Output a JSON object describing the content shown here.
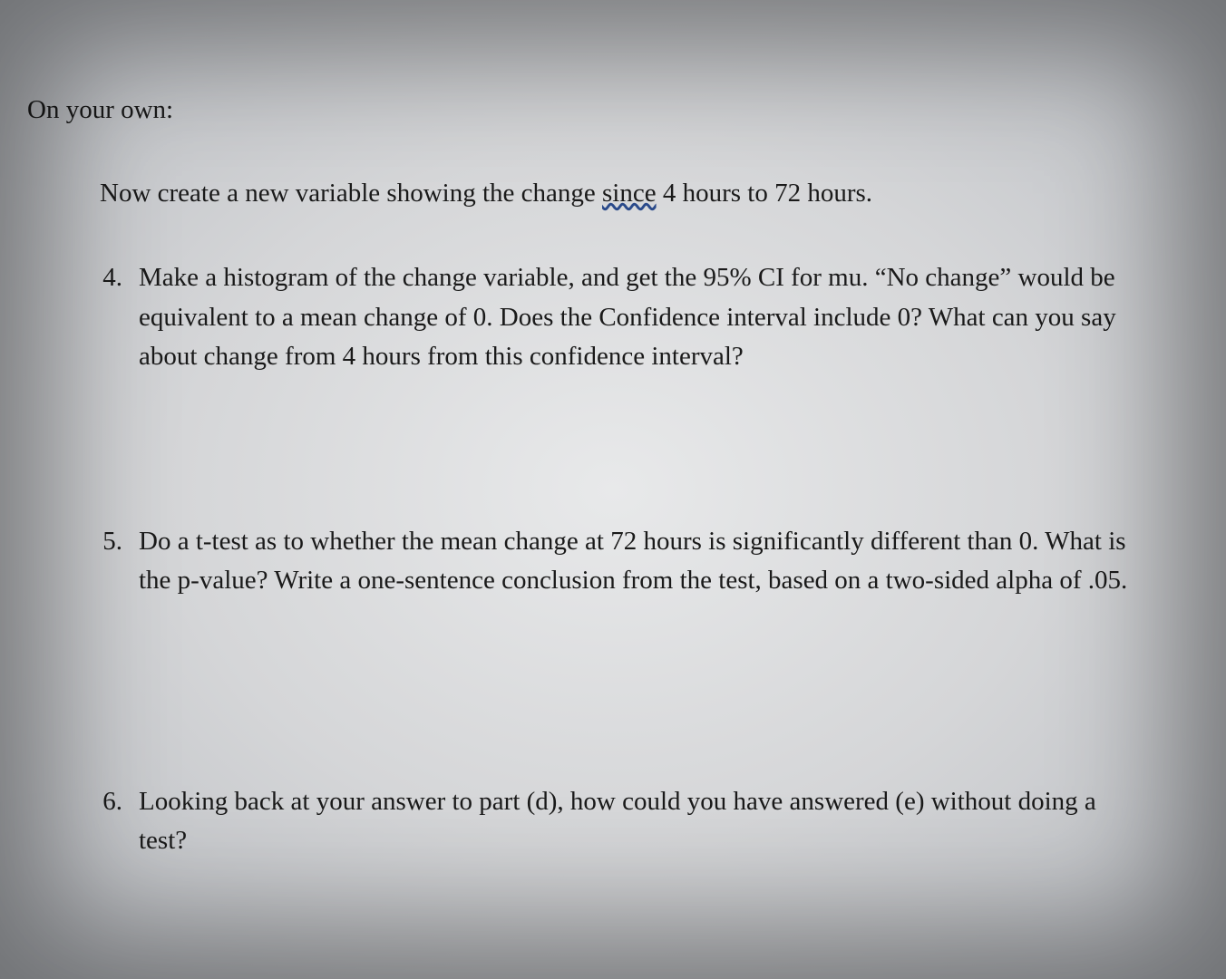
{
  "heading": "On your own:",
  "intro_before": "Now create a new variable showing the change ",
  "intro_underlined": "since",
  "intro_after": " 4 hours to 72 hours.",
  "questions": [
    {
      "num": "4.",
      "text": "Make a histogram of the change variable, and get the 95% CI for mu. “No change” would be equivalent to a mean change of 0. Does the Confidence interval include 0? What can you say about change from 4 hours from this confidence interval?"
    },
    {
      "num": "5.",
      "text": "Do a t-test as to whether the mean change at 72 hours is significantly different than 0. What is the p-value? Write a one-sentence conclusion from the test, based on a two-sided alpha of .05."
    },
    {
      "num": "6.",
      "text": "Looking back at your answer to part (d), how could you have answered (e) without doing a test?"
    }
  ]
}
